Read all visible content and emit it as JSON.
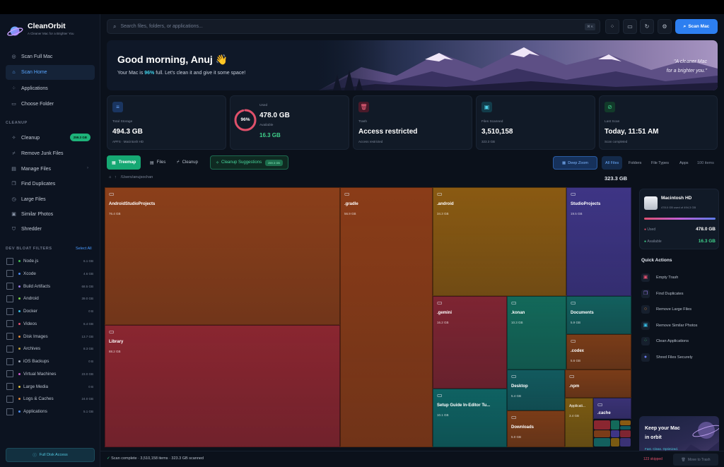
{
  "app": {
    "name": "CleanOrbit",
    "tagline": "A Cleaner Mac for a Brighter You"
  },
  "sidebar": {
    "nav": [
      {
        "label": "Scan Full Mac",
        "icon": "target-icon"
      },
      {
        "label": "Scan Home",
        "icon": "home-icon",
        "active": true
      },
      {
        "label": "Applications",
        "icon": "grid-icon"
      },
      {
        "label": "Choose Folder",
        "icon": "folder-icon"
      }
    ],
    "cleanup_title": "CLEANUP",
    "cleanup": [
      {
        "label": "Cleanup",
        "badge": "259.3 GB"
      },
      {
        "label": "Remove Junk Files"
      },
      {
        "label": "Manage Files"
      },
      {
        "label": "Find Duplicates"
      },
      {
        "label": "Large Files"
      },
      {
        "label": "Similar Photos"
      },
      {
        "label": "Shredder"
      }
    ],
    "bloat_title": "DEV BLOAT FILTERS",
    "select_all": "Select All",
    "bloat": [
      {
        "label": "Node.js",
        "size": "6.1 GB",
        "color": "#3fb950"
      },
      {
        "label": "Xcode",
        "size": "4.6 GB",
        "color": "#4a8cf0"
      },
      {
        "label": "Build Artifacts",
        "size": "68.5 GB",
        "color": "#9a7bea"
      },
      {
        "label": "Android",
        "size": "39.0 GB",
        "color": "#7bd34a"
      },
      {
        "label": "Docker",
        "size": "0 B",
        "color": "#36b8e0"
      },
      {
        "label": "Videos",
        "size": "6.4 GB",
        "color": "#e05070"
      },
      {
        "label": "Disk Images",
        "size": "13.7 GB",
        "color": "#e08a3a"
      },
      {
        "label": "Archives",
        "size": "8.3 GB",
        "color": "#c2a23a"
      },
      {
        "label": "iOS Backups",
        "size": "0 B",
        "color": "#9aa3b2"
      },
      {
        "label": "Virtual Machines",
        "size": "23.0 GB",
        "color": "#d05ad0"
      },
      {
        "label": "Large Media",
        "size": "0 B",
        "color": "#e0c040"
      },
      {
        "label": "Logs & Caches",
        "size": "24.0 GB",
        "color": "#e08a3a"
      },
      {
        "label": "Applications",
        "size": "5.1 GB",
        "color": "#4a8cf0"
      }
    ],
    "full_disk": "Full Disk Access"
  },
  "topbar": {
    "search_placeholder": "Search files, folders, or applications...",
    "shortcut": "⌘ K",
    "scan_button": "Scan Mac"
  },
  "hero": {
    "greeting": "Good morning, Anuj 👋",
    "line_prefix": "Your Mac is ",
    "line_pct": "96%",
    "line_suffix": " full. Let's clean it and give it some space!",
    "quote": "\"A cleaner Mac\nfor a brighter you.\""
  },
  "stats": {
    "total": {
      "label": "Total Storage",
      "value": "494.3 GB",
      "sub": "APFS · Macintosh HD"
    },
    "used": {
      "label": "Used",
      "value": "478.0 GB",
      "pct": "96%",
      "pct_value": 0.96,
      "avail_label": "Available",
      "avail": "16.3 GB"
    },
    "trash": {
      "label": "Trash",
      "value": "Access restricted",
      "sub": "Access restricted"
    },
    "files": {
      "label": "Files Scanned",
      "value": "3,510,158",
      "sub": "323.3 GB"
    },
    "last": {
      "label": "Last Scan",
      "value": "Today, 11:51 AM",
      "sub": "Scan completed"
    }
  },
  "tabs": {
    "treemap": "Treemap",
    "files": "Files",
    "cleanup": "Cleanup",
    "suggestions": "Cleanup Suggestions",
    "suggestions_badge": "259.3 GB",
    "deep_zoom": "Deep Zoom",
    "filters": [
      "All Files",
      "Folders",
      "File Types",
      "Apps"
    ],
    "items": "100 items"
  },
  "path": {
    "text": "/Users/anujsochan",
    "total": "323.3 GB"
  },
  "treemap": [
    {
      "name": "AndroidStudioProjects",
      "size": "76.4 GB",
      "color": "#8b3f1a"
    },
    {
      "name": "Library",
      "size": "88.2 GB",
      "color": "#8a2630"
    },
    {
      "name": ".gradle",
      "size": "56.9 GB",
      "color": "#8a3c18"
    },
    {
      "name": ".android",
      "size": "34.3 GB",
      "color": "#8a5a12"
    },
    {
      "name": "StudioProjects",
      "size": "19.5 GB",
      "color": "#3e3585"
    },
    {
      "name": ".gemini",
      "size": "16.2 GB",
      "color": "#7e2532"
    },
    {
      "name": ".konan",
      "size": "10.3 GB",
      "color": "#13695a"
    },
    {
      "name": "Documents",
      "size": "5.9 GB",
      "color": "#13605e"
    },
    {
      "name": ".codex",
      "size": "5.6 GB",
      "color": "#7a3c18"
    },
    {
      "name": "Setup Guide In-Editor Tu...",
      "size": "10.1 GB",
      "color": "#0f6262"
    },
    {
      "name": "Desktop",
      "size": "5.4 GB",
      "color": "#125a5e"
    },
    {
      "name": ".npm",
      "size": "",
      "color": "#7a3c18"
    },
    {
      "name": "Downloads",
      "size": "5.0 GB",
      "color": "#7a3c18"
    },
    {
      "name": "Applicati...",
      "size": "3.4 GB",
      "color": "#7a5a12"
    },
    {
      "name": ".cache",
      "size": "",
      "color": "#3a3275"
    }
  ],
  "disk": {
    "name": "Macintosh HD",
    "desc": "478.0 GB used of 494.3 GB",
    "used_label": "Used",
    "used": "478.0 GB",
    "avail_label": "Available",
    "avail": "16.3 GB"
  },
  "quick_actions": {
    "title": "Quick Actions",
    "items": [
      {
        "label": "Empty Trash",
        "color": "#e05070"
      },
      {
        "label": "Find Duplicates",
        "color": "#9a7bea"
      },
      {
        "label": "Remove Large Files",
        "color": "#e08a3a"
      },
      {
        "label": "Remove Similar Photos",
        "color": "#36b8e0"
      },
      {
        "label": "Clean Applications",
        "color": "#3fb970"
      },
      {
        "label": "Shred Files Securely",
        "color": "#6b7cf0"
      }
    ]
  },
  "promo": {
    "title": "Keep your Mac\nin orbit",
    "sub": "Fast. Clean. Optimized."
  },
  "status": {
    "text": "Scan complete · 3,510,158 items · 323.3 GB scanned",
    "skipped": "123 skipped",
    "move": "Move to Trash"
  }
}
